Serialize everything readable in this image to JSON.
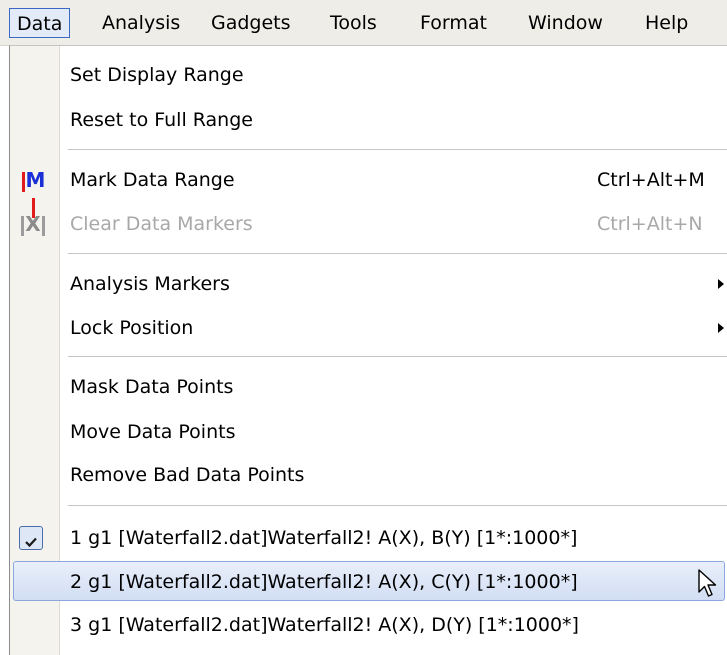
{
  "menubar": {
    "items": [
      {
        "label": "Data"
      },
      {
        "label": "Analysis"
      },
      {
        "label": "Gadgets"
      },
      {
        "label": "Tools"
      },
      {
        "label": "Format"
      },
      {
        "label": "Window"
      },
      {
        "label": "Help"
      }
    ]
  },
  "menu": {
    "set_display_range": "Set Display Range",
    "reset_full_range": "Reset to Full Range",
    "mark_data_range": {
      "label": "Mark Data Range",
      "shortcut": "Ctrl+Alt+M"
    },
    "clear_data_markers": {
      "label": "Clear Data Markers",
      "shortcut": "Ctrl+Alt+N",
      "enabled": false
    },
    "analysis_markers": "Analysis Markers",
    "lock_position": "Lock Position",
    "mask_data_points": "Mask Data Points",
    "move_data_points": "Move Data Points",
    "remove_bad_data_points": "Remove Bad Data Points",
    "datasets": [
      {
        "label": "1 g1 [Waterfall2.dat]Waterfall2! A(X), B(Y) [1*:1000*]",
        "checked": true
      },
      {
        "label": "2 g1 [Waterfall2.dat]Waterfall2! A(X), C(Y) [1*:1000*]",
        "checked": false,
        "highlighted": true
      },
      {
        "label": "3 g1 [Waterfall2.dat]Waterfall2! A(X), D(Y) [1*:1000*]",
        "checked": false
      }
    ]
  },
  "icons": {
    "mark": "M",
    "clear": "X"
  }
}
